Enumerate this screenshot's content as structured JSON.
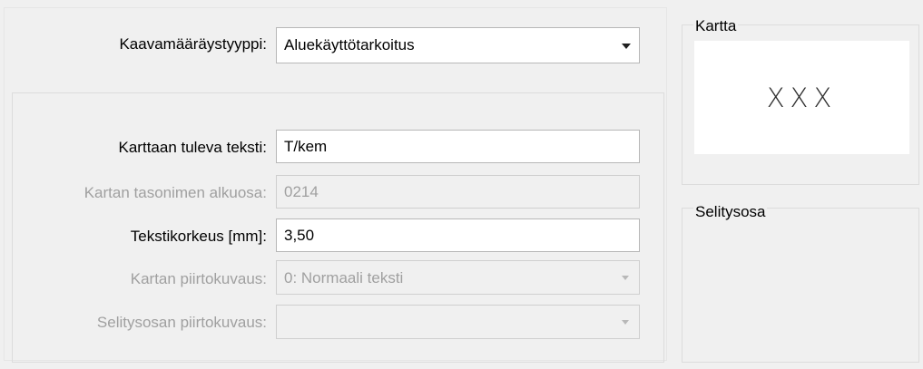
{
  "form": {
    "rule_type": {
      "label": "Kaavamääräystyyppi:",
      "value": "Aluekäyttötarkoitus"
    },
    "map_text": {
      "label": "Karttaan tuleva teksti:",
      "value": "T/kem"
    },
    "layer_prefix": {
      "label": "Kartan tasonimen alkuosa:",
      "value": "0214"
    },
    "text_height": {
      "label": "Tekstikorkeus [mm]:",
      "value": "3,50"
    },
    "map_style": {
      "label": "Kartan piirtokuvaus:",
      "value": "0: Normaali teksti"
    },
    "legend_style": {
      "label": "Selitysosan piirtokuvaus:",
      "value": ""
    }
  },
  "preview": {
    "map_title": "Kartta",
    "map_text": "XXX",
    "legend_title": "Selitysosa"
  }
}
